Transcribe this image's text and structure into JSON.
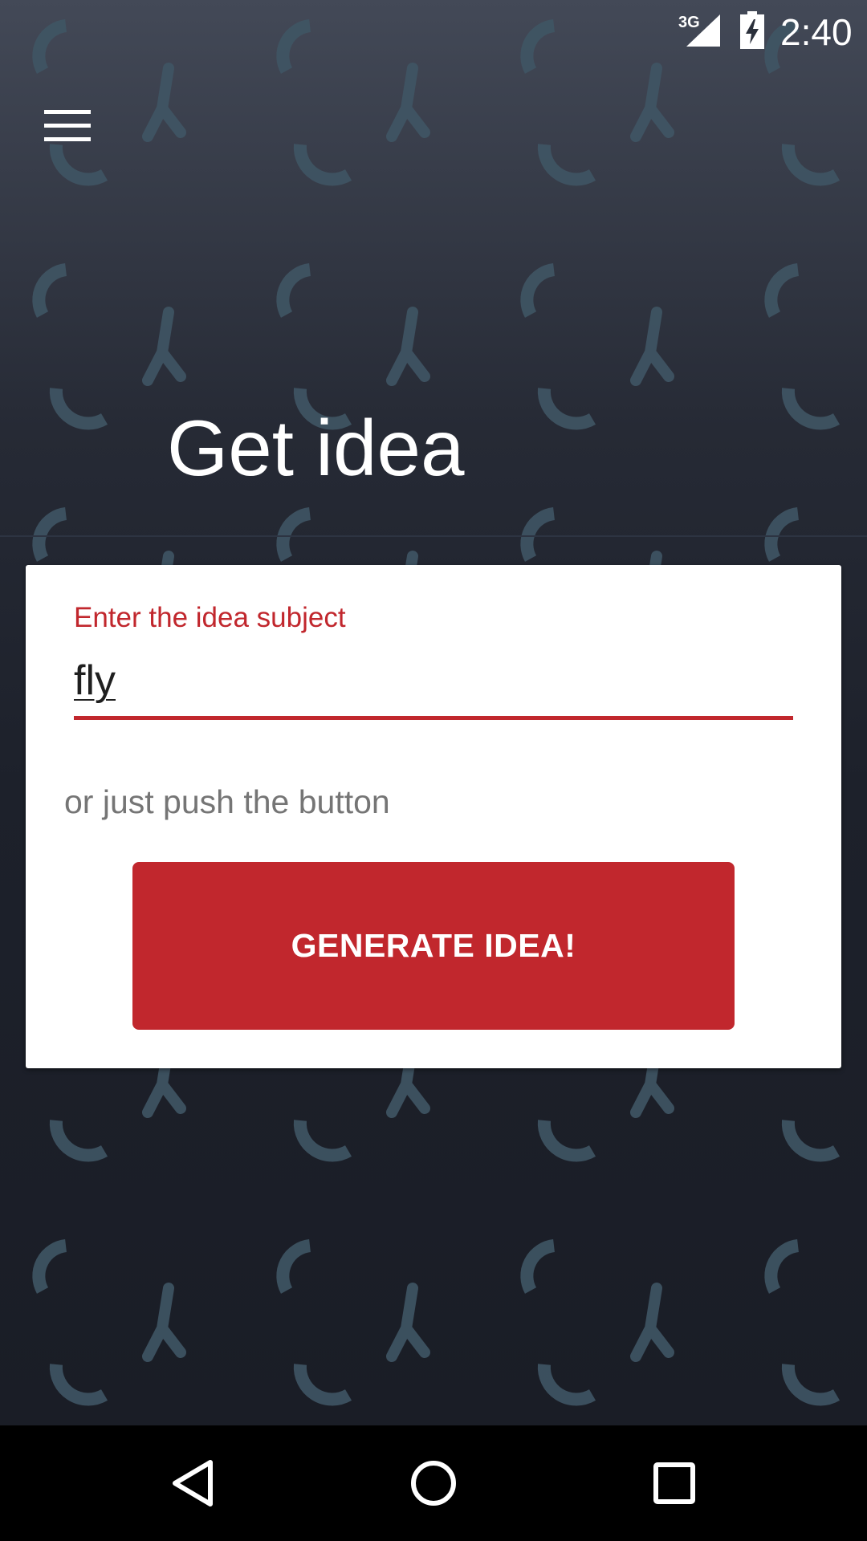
{
  "status_bar": {
    "network": "3G",
    "time": "2:40"
  },
  "header": {
    "menu_icon": "hamburger-menu-icon",
    "title": "Get idea"
  },
  "card": {
    "input_label": "Enter the idea subject",
    "input_value": "fly",
    "hint": "or just push the button",
    "button_label": "GENERATE IDEA!"
  },
  "nav_bar": {
    "back_icon": "back-triangle-icon",
    "home_icon": "home-circle-icon",
    "recents_icon": "recents-square-icon"
  },
  "colors": {
    "accent": "#c1272d",
    "background_top": "#434957",
    "background_bottom": "#1a1d26",
    "pattern": "#3f5564"
  }
}
